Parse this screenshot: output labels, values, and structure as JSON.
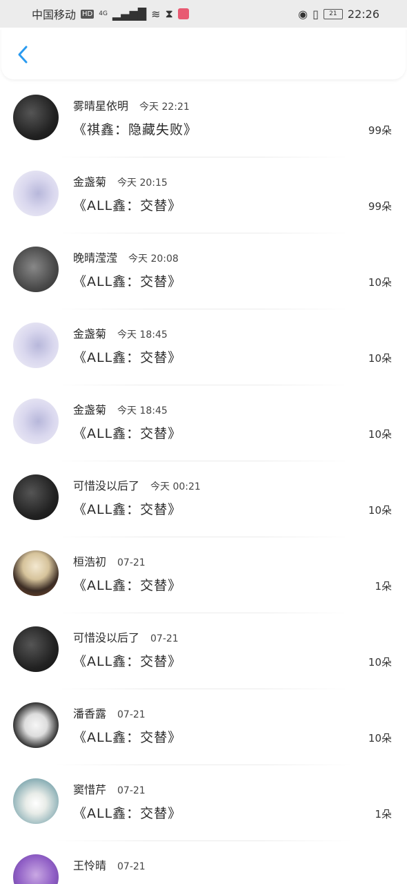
{
  "status_bar": {
    "carrier": "中国移动",
    "hd": "HD",
    "network": "4G",
    "battery": "21",
    "time": "22:26"
  },
  "header": {
    "back_icon": "chevron-left-icon",
    "accent": "#2a9bf0"
  },
  "rows": [
    {
      "name": "雾晴星依明",
      "time": "今天 22:21",
      "title": "《祺鑫：隐藏失败》",
      "count": "99朵",
      "avatar": "dark"
    },
    {
      "name": "金盏菊",
      "time": "今天 20:15",
      "title": "《ALL鑫：交替》",
      "count": "99朵",
      "avatar": "lilac"
    },
    {
      "name": "晚晴滢滢",
      "time": "今天 20:08",
      "title": "《ALL鑫：交替》",
      "count": "10朵",
      "avatar": "grey"
    },
    {
      "name": "金盏菊",
      "time": "今天 18:45",
      "title": "《ALL鑫：交替》",
      "count": "10朵",
      "avatar": "lilac"
    },
    {
      "name": "金盏菊",
      "time": "今天 18:45",
      "title": "《ALL鑫：交替》",
      "count": "10朵",
      "avatar": "lilac"
    },
    {
      "name": "可惜没以后了",
      "time": "今天 00:21",
      "title": "《ALL鑫：交替》",
      "count": "10朵",
      "avatar": "dark"
    },
    {
      "name": "桓浩初",
      "time": "07-21",
      "title": "《ALL鑫：交替》",
      "count": "1朵",
      "avatar": "blonde"
    },
    {
      "name": "可惜没以后了",
      "time": "07-21",
      "title": "《ALL鑫：交替》",
      "count": "10朵",
      "avatar": "dark"
    },
    {
      "name": "潘香露",
      "time": "07-21",
      "title": "《ALL鑫：交替》",
      "count": "10朵",
      "avatar": "bunny"
    },
    {
      "name": "窦惜芹",
      "time": "07-21",
      "title": "《ALL鑫：交替》",
      "count": "1朵",
      "avatar": "flower"
    },
    {
      "name": "王怜晴",
      "time": "07-21",
      "title": "",
      "count": "",
      "avatar": "purple"
    }
  ]
}
